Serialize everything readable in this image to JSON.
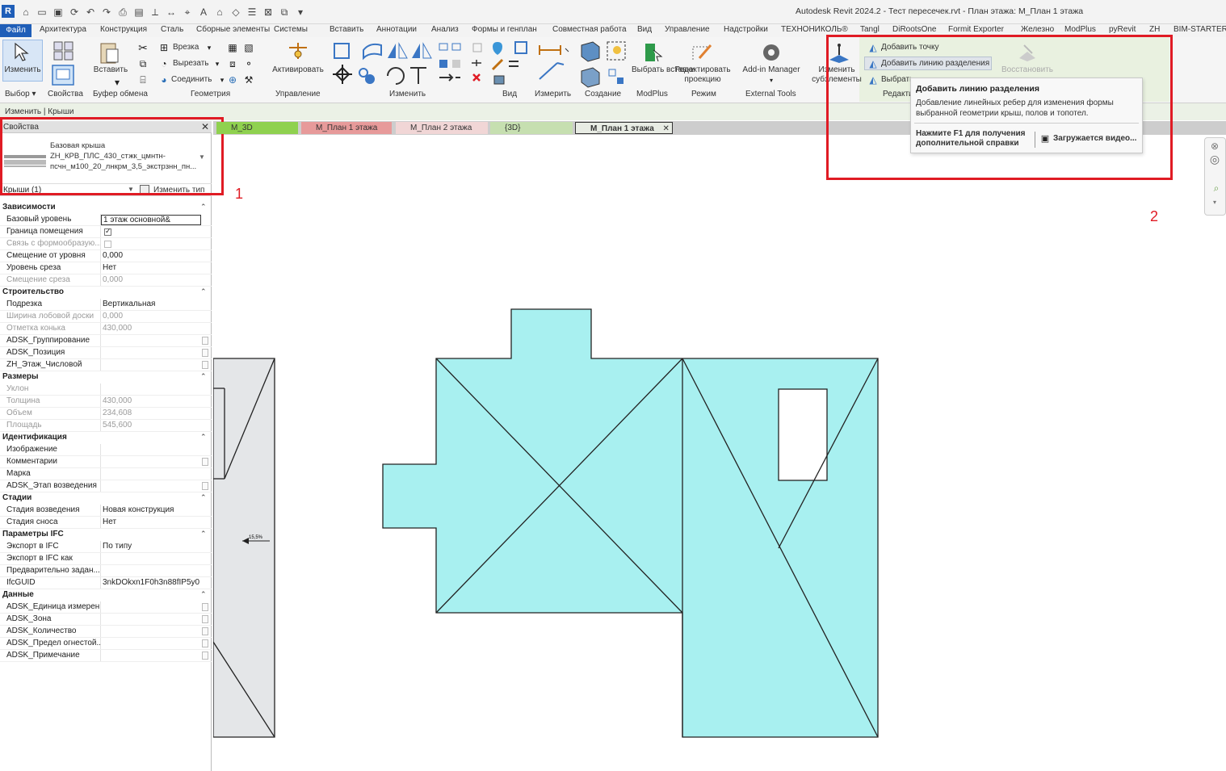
{
  "app": {
    "title": "Autodesk Revit 2024.2 - Тест пересечек.rvt - План этажа: М_План 1 этажа",
    "logo": "R"
  },
  "menu": {
    "file": "Файл",
    "items": [
      "Архитектура",
      "Конструкция",
      "Сталь",
      "Сборные элементы",
      "Системы",
      "Вставить",
      "Аннотации",
      "Анализ",
      "Формы и генплан",
      "Совместная работа",
      "Вид",
      "Управление",
      "Надстройки",
      "ТЕХНОНИКОЛЬ®",
      "Tangl",
      "DiRootsOne",
      "Formit Exporter",
      "Железно",
      "ModPlus",
      "pyRevit",
      "ZH",
      "BIM-STARTER"
    ]
  },
  "ribbon": {
    "select": "Изменить",
    "properties": "Свойства",
    "paste": "Вставить",
    "cut": "Врезка",
    "cut2": "Вырезать",
    "join": "Соединить",
    "activate": "Активировать",
    "pick_insert": "Выбрать вставки",
    "edit_projection": "Редактировать проекцию",
    "addin_manager": "Add-in Manager",
    "modify_sub": "Изменить субэлементы",
    "add_point": "Добавить точку",
    "add_split_line": "Добавить линию разделения",
    "pick": "Выбрать",
    "restore": "Восстановить",
    "groups": {
      "select": "Выбор",
      "props": "Свойства",
      "clipboard": "Буфер обмена",
      "geometry": "Геометрия",
      "control": "Управление",
      "modify": "Изменить",
      "view": "Вид",
      "measure": "Измерить",
      "create": "Создание",
      "modplus": "ModPlus",
      "mode": "Режим",
      "external": "External Tools",
      "edit": "Редакти"
    }
  },
  "context": "Изменить | Крыши",
  "tabs": [
    {
      "label": "М_3D",
      "color": "#8fd14f"
    },
    {
      "label": "М_План 1 этажа",
      "color": "#e79a9a"
    },
    {
      "label": "М_План 2 этажа",
      "color": "#f1d6d6"
    },
    {
      "label": "{3D}",
      "color": "#c6dfb0"
    },
    {
      "label": "М_План 1 этажа",
      "color": "#e8ece4",
      "active": true
    }
  ],
  "properties": {
    "title": "Свойства",
    "type_line1": "Базовая крыша",
    "type_line2": "ZH_КРВ_ПЛС_430_стжк_цмнтн-",
    "type_line3": "псчн_м100_20_лнкрм_3,5_экстрзнн_пн...",
    "filter": "Крыши (1)",
    "edit_type": "Изменить тип",
    "categories": [
      {
        "label": "Зависимости",
        "rows": [
          {
            "name": "Базовый уровень",
            "value": "1 этаж основной&",
            "input": true
          },
          {
            "name": "Граница помещения",
            "check": "on"
          },
          {
            "name": "Связь с формообразую...",
            "check": "dis",
            "disabled": true
          },
          {
            "name": "Смещение от уровня",
            "value": "0,000"
          },
          {
            "name": "Уровень среза",
            "value": "Нет"
          },
          {
            "name": "Смещение среза",
            "value": "0,000",
            "disabled": true
          }
        ]
      },
      {
        "label": "Строительство",
        "rows": [
          {
            "name": "Подрезка",
            "value": "Вертикальная"
          },
          {
            "name": "Ширина лобовой доски",
            "value": "0,000",
            "disabled": true
          },
          {
            "name": "Отметка конька",
            "value": "430,000",
            "disabled": true
          },
          {
            "name": "ADSK_Группирование",
            "value": "",
            "btn": true
          },
          {
            "name": "ADSK_Позиция",
            "value": "",
            "btn": true
          },
          {
            "name": "ZH_Этаж_Числовой",
            "value": "",
            "btn": true
          }
        ]
      },
      {
        "label": "Размеры",
        "rows": [
          {
            "name": "Уклон",
            "value": "",
            "disabled": true
          },
          {
            "name": "Толщина",
            "value": "430,000",
            "disabled": true
          },
          {
            "name": "Объем",
            "value": "234,608",
            "disabled": true
          },
          {
            "name": "Площадь",
            "value": "545,600",
            "disabled": true
          }
        ]
      },
      {
        "label": "Идентификация",
        "rows": [
          {
            "name": "Изображение",
            "value": ""
          },
          {
            "name": "Комментарии",
            "value": "",
            "btn": true
          },
          {
            "name": "Марка",
            "value": ""
          },
          {
            "name": "ADSK_Этап возведения",
            "value": "",
            "btn": true
          }
        ]
      },
      {
        "label": "Стадии",
        "rows": [
          {
            "name": "Стадия возведения",
            "value": "Новая конструкция"
          },
          {
            "name": "Стадия сноса",
            "value": "Нет"
          }
        ]
      },
      {
        "label": "Параметры IFC",
        "rows": [
          {
            "name": "Экспорт в IFC",
            "value": "По типу"
          },
          {
            "name": "Экспорт в IFC как",
            "value": ""
          },
          {
            "name": "Предварительно задан...",
            "value": ""
          },
          {
            "name": "IfcGUID",
            "value": "3nkDOkxn1F0h3n88fIP5y0"
          }
        ]
      },
      {
        "label": "Данные",
        "rows": [
          {
            "name": "ADSK_Единица измерен...",
            "value": "",
            "btn": true
          },
          {
            "name": "ADSK_Зона",
            "value": "",
            "btn": true
          },
          {
            "name": "ADSK_Количество",
            "value": "",
            "btn": true
          },
          {
            "name": "ADSK_Предел огнестой...",
            "value": "",
            "btn": true
          },
          {
            "name": "ADSK_Примечание",
            "value": "",
            "btn": true
          }
        ]
      }
    ]
  },
  "tooltip": {
    "title": "Добавить линию разделения",
    "desc1": "Добавление линейных ребер для изменения формы",
    "desc2": "выбранной геометрии крыш, полов и топотел.",
    "help1": "Нажмите F1 для получения",
    "help2": "дополнительной справки",
    "video": "Загружается видео..."
  },
  "annotations": {
    "one": "1",
    "two": "2"
  },
  "canvas": {
    "spot_label": "15,5%"
  },
  "colors": {
    "roof_fill": "#a8f0f0",
    "accent": "#1f5eb8",
    "annot": "#e01b24"
  }
}
